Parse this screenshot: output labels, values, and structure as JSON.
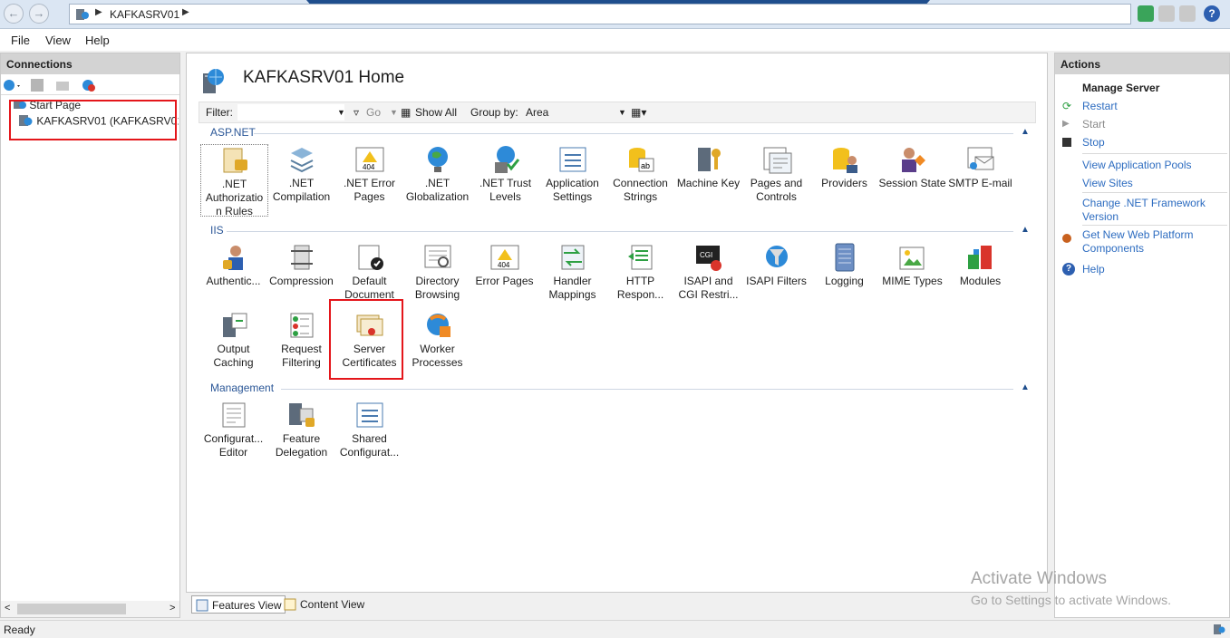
{
  "address": {
    "crumb": "KAFKASRV01"
  },
  "menu": {
    "file": "File",
    "view": "View",
    "help": "Help"
  },
  "connections": {
    "title": "Connections",
    "tree": {
      "start_page": "Start Page",
      "server": "KAFKASRV01 (KAFKASRV01\\A"
    }
  },
  "main": {
    "title": "KAFKASRV01 Home",
    "filter_label": "Filter:",
    "go_label": "Go",
    "show_all_label": "Show All",
    "group_by_label": "Group by:",
    "group_by_value": "Area",
    "sections": {
      "aspnet": "ASP.NET",
      "iis": "IIS",
      "management": "Management"
    },
    "aspnet_features": [
      ".NET Authorizatio n Rules",
      ".NET Compilation",
      ".NET Error Pages",
      ".NET Globalization",
      ".NET Trust Levels",
      "Application Settings",
      "Connection Strings",
      "Machine Key",
      "Pages and Controls",
      "Providers",
      "Session State",
      "SMTP E-mail"
    ],
    "iis_features": [
      "Authentic...",
      "Compression",
      "Default Document",
      "Directory Browsing",
      "Error Pages",
      "Handler Mappings",
      "HTTP Respon...",
      "ISAPI and CGI Restri...",
      "ISAPI Filters",
      "Logging",
      "MIME Types",
      "Modules",
      "Output Caching",
      "Request Filtering",
      "Server Certificates",
      "Worker Processes"
    ],
    "management_features": [
      "Configurat... Editor",
      "Feature Delegation",
      "Shared Configurat..."
    ]
  },
  "tabs": {
    "features_view": "Features View",
    "content_view": "Content View"
  },
  "actions": {
    "title": "Actions",
    "group": "Manage Server",
    "restart": "Restart",
    "start": "Start",
    "stop": "Stop",
    "view_app_pools": "View Application Pools",
    "view_sites": "View Sites",
    "change_net": "Change .NET Framework Version",
    "get_web_platform": "Get New Web Platform Components",
    "help": "Help"
  },
  "watermark": {
    "line1": "Activate Windows",
    "line2": "Go to Settings to activate Windows."
  },
  "status": {
    "text": "Ready"
  },
  "colors": {
    "highlight": "#e4161b",
    "link": "#2d6cc0",
    "section": "#2b5797"
  }
}
